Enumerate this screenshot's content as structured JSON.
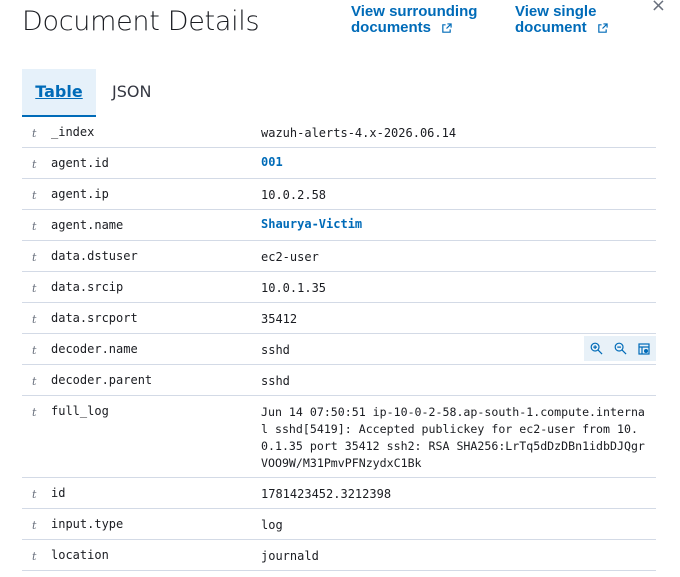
{
  "header": {
    "title": "Document Details",
    "surrounding_link": "View surrounding documents",
    "single_link": "View single document"
  },
  "tabs": [
    {
      "label": "Table",
      "active": true
    },
    {
      "label": "JSON",
      "active": false
    }
  ],
  "rows": [
    {
      "field": "_index",
      "value": "wazuh-alerts-4.x-2026.06.14",
      "link": false
    },
    {
      "field": "agent.id",
      "value": "001",
      "link": true
    },
    {
      "field": "agent.ip",
      "value": "10.0.2.58",
      "link": false
    },
    {
      "field": "agent.name",
      "value": "Shaurya-Victim",
      "link": true
    },
    {
      "field": "data.dstuser",
      "value": "ec2-user",
      "link": false
    },
    {
      "field": "data.srcip",
      "value": "10.0.1.35",
      "link": false
    },
    {
      "field": "data.srcport",
      "value": "35412",
      "link": false
    },
    {
      "field": "decoder.name",
      "value": "sshd",
      "link": false,
      "hovered": true
    },
    {
      "field": "decoder.parent",
      "value": "sshd",
      "link": false
    },
    {
      "field": "full_log",
      "value": "Jun 14 07:50:51 ip-10-0-2-58.ap-south-1.compute.internal sshd[5419]: Accepted publickey for ec2-user from 10.0.1.35 port 35412 ssh2: RSA SHA256:LrTq5dDzDBn1idbDJQgrVOO9W/M31PmvPFNzydxC1Bk",
      "link": false
    },
    {
      "field": "id",
      "value": "1781423452.3212398",
      "link": false
    },
    {
      "field": "input.type",
      "value": "log",
      "link": false
    },
    {
      "field": "location",
      "value": "journald",
      "link": false
    }
  ],
  "icons": {
    "field_type": "t",
    "close": "×"
  },
  "colors": {
    "accent": "#006bb8",
    "row_hover": "#e8f1f8"
  }
}
